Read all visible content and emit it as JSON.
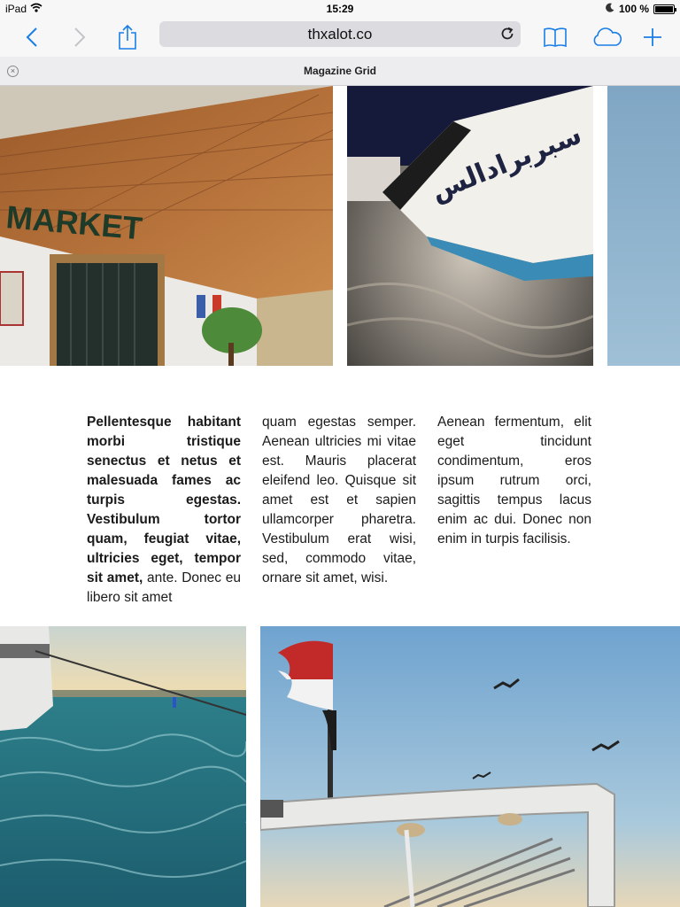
{
  "status_bar": {
    "device": "iPad",
    "time": "15:29",
    "battery": "100 %",
    "battery_level": 1.0
  },
  "toolbar": {
    "url": "thxalot.co",
    "icons": [
      "back-icon",
      "forward-icon",
      "share-icon",
      "reload-icon",
      "bookmarks-icon",
      "icloud-tabs-icon",
      "new-tab-icon"
    ]
  },
  "tab": {
    "title": "Magazine Grid"
  },
  "photos": {
    "market_sign": "MARKET"
  },
  "article": {
    "lead": "Pellentesque habitant morbi tristique senectus et netus et malesuada fames ac turpis egestas. Vestibulum tortor quam, feugiat vitae, ultricies eget, tempor sit amet,",
    "col1_rest": " ante. Donec eu libero sit amet",
    "col2": "quam egestas semper. Aenean ultricies mi vitae est. Mauris placerat eleifend leo. Quisque sit amet est et sapien ullamcorper pharetra. Vestibulum erat wisi, sed, commodo vitae, ornare sit amet, wisi.",
    "col3": "Aenean fermentum, elit eget tincidunt condimentum, eros ipsum rutrum orci, sagittis tempus lacus enim ac dui. Donec non enim in turpis facilisis."
  },
  "colors": {
    "accent": "#1a7ee6",
    "chrome": "#f7f7f8",
    "address_bar": "#dcdce0"
  }
}
